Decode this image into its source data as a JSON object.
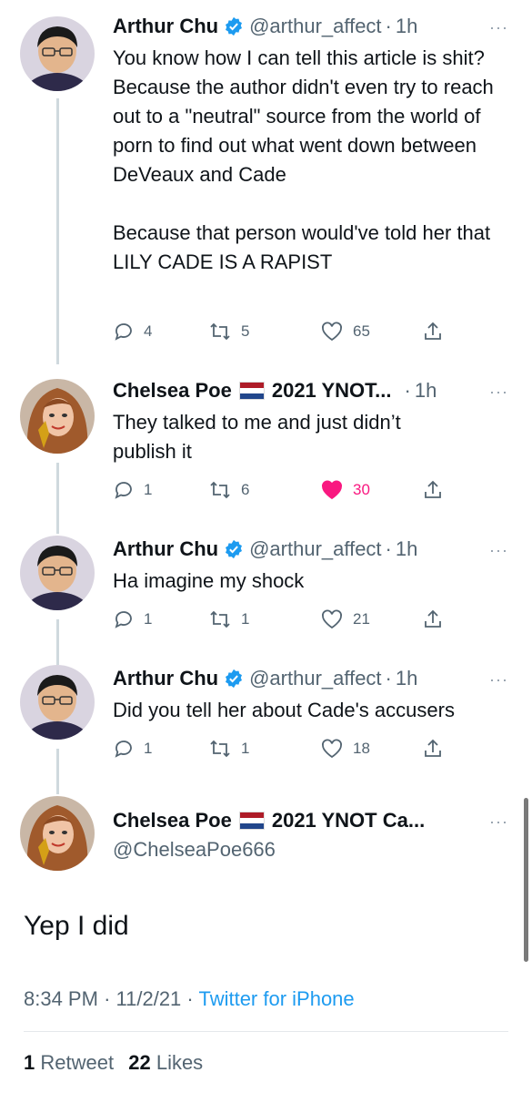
{
  "tweets": [
    {
      "name": "Arthur Chu",
      "handle": "@arthur_affect",
      "time": "1h",
      "text": "You know how I can tell this article is shit? Because the author didn't even try to reach out to a \"neutral\" source from the world of porn to find out what went down between DeVeaux and Cade\n\nBecause that person would've told her that LILY CADE IS A RAPIST",
      "replies": "4",
      "retweets": "5",
      "likes": "65"
    },
    {
      "name": "Chelsea Poe",
      "display_suffix": "2021 YNOT...",
      "time": "1h",
      "text": "They talked to me and just didn’t publish it",
      "replies": "1",
      "retweets": "6",
      "likes": "30"
    },
    {
      "name": "Arthur Chu",
      "handle": "@arthur_affect",
      "time": "1h",
      "text": "Ha imagine my shock",
      "replies": "1",
      "retweets": "1",
      "likes": "21"
    },
    {
      "name": "Arthur Chu",
      "handle": "@arthur_affect",
      "time": "1h",
      "text": "Did you tell her about Cade's accusers",
      "replies": "1",
      "retweets": "1",
      "likes": "18"
    }
  ],
  "main_tweet": {
    "name": "Chelsea Poe",
    "display_suffix": "2021 YNOT Ca...",
    "handle": "@ChelseaPoe666",
    "text": "Yep I did",
    "time": "8:34 PM",
    "date": "11/2/21",
    "source": "Twitter for iPhone",
    "retweets_count": "1",
    "retweets_label": "Retweet",
    "likes_count": "22",
    "likes_label": "Likes"
  },
  "ui": {
    "separator": "·",
    "more": "···"
  },
  "colors": {
    "accent": "#1d9bf0",
    "like": "#f91880",
    "muted": "#536471"
  },
  "icons": [
    "verified-badge-icon",
    "netherlands-flag-icon",
    "reply-icon",
    "retweet-icon",
    "like-icon",
    "share-icon",
    "more-icon"
  ]
}
